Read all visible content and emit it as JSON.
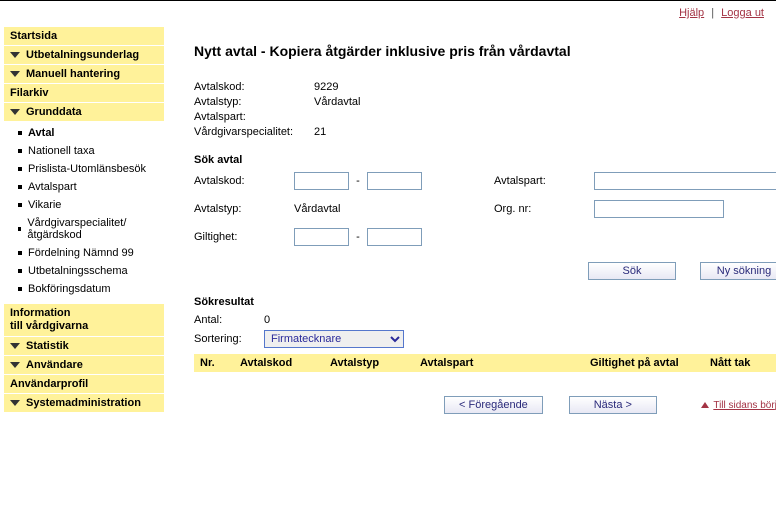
{
  "header": {
    "help_link": "Hjälp",
    "logout_link": "Logga ut"
  },
  "sidebar": {
    "startsida": "Startsida",
    "utbetalningsunderlag": "Utbetalningsunderlag",
    "manuell_hantering": "Manuell hantering",
    "filarkiv": "Filarkiv",
    "grunddata": "Grunddata",
    "grunddata_items": [
      "Avtal",
      "Nationell taxa",
      "Prislista-Utomlänsbesök",
      "Avtalspart",
      "Vikarie",
      "Vårdgivarspecialitet/ åtgärdskod",
      "Fördelning Nämnd 99",
      "Utbetalningsschema",
      "Bokföringsdatum"
    ],
    "information": "Information\ntill vårdgivarna",
    "statistik": "Statistik",
    "anvandare": "Användare",
    "anvandarprofil": "Användarprofil",
    "systemadministration": "Systemadministration"
  },
  "main": {
    "title": "Nytt avtal - Kopiera åtgärder inklusive pris från vårdavtal",
    "details": {
      "avtalskod_label": "Avtalskod:",
      "avtalskod_value": "9229",
      "avtalstyp_label": "Avtalstyp:",
      "avtalstyp_value": "Vårdavtal",
      "avtalspart_label": "Avtalspart:",
      "avtalspart_value": "",
      "spec_label": "Vårdgivarspecialitet:",
      "spec_value": "21"
    },
    "search": {
      "heading": "Sök avtal",
      "avtalskod_label": "Avtalskod:",
      "avtalspart_label": "Avtalspart:",
      "avtalstyp_label": "Avtalstyp:",
      "avtalstyp_value": "Vårdavtal",
      "orgnr_label": "Org. nr:",
      "giltighet_label": "Giltighet:",
      "btn_sok": "Sök",
      "btn_ny": "Ny sökning"
    },
    "result": {
      "heading": "Sökresultat",
      "antal_label": "Antal:",
      "antal_value": "0",
      "sortering_label": "Sortering:",
      "sortering_value": "Firmatecknare",
      "cols": {
        "nr": "Nr.",
        "avtalskod": "Avtalskod",
        "avtalstyp": "Avtalstyp",
        "avtalspart": "Avtalspart",
        "giltighet": "Giltighet på avtal",
        "natt_tak": "Nått tak"
      }
    },
    "footer": {
      "prev": "< Föregående",
      "next": "Nästa >",
      "back_top": "Till sidans början"
    }
  }
}
